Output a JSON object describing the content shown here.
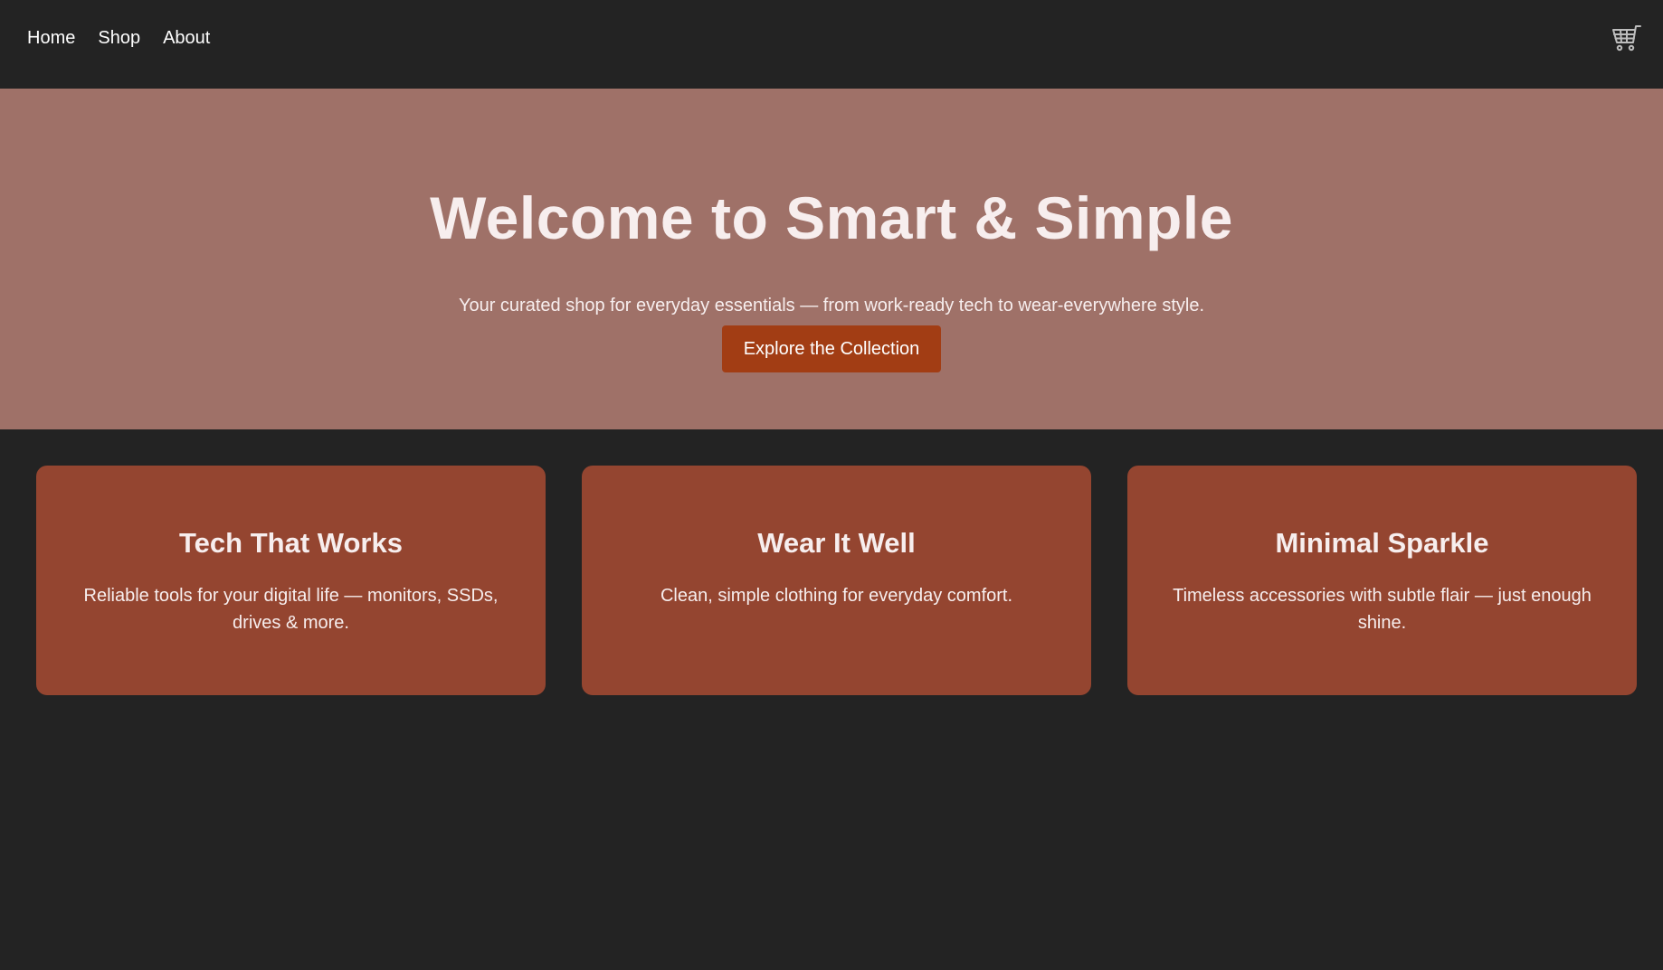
{
  "nav": {
    "links": [
      "Home",
      "Shop",
      "About"
    ],
    "cart_icon": "shopping-cart-icon"
  },
  "hero": {
    "title": "Welcome to Smart & Simple",
    "subtitle": "Your curated shop for everyday essentials — from work-ready tech to wear-everywhere style.",
    "cta_label": "Explore the Collection"
  },
  "cards": [
    {
      "title": "Tech That Works",
      "description": "Reliable tools for your digital life — monitors, SSDs, drives & more."
    },
    {
      "title": "Wear It Well",
      "description": "Clean, simple clothing for everyday comfort."
    },
    {
      "title": "Minimal Sparkle",
      "description": "Timeless accessories with subtle flair — just enough shine."
    }
  ],
  "colors": {
    "background": "#232323",
    "hero": "#9f7168",
    "card": "#944530",
    "button": "#a23d14",
    "text_light": "#f7eeee"
  }
}
